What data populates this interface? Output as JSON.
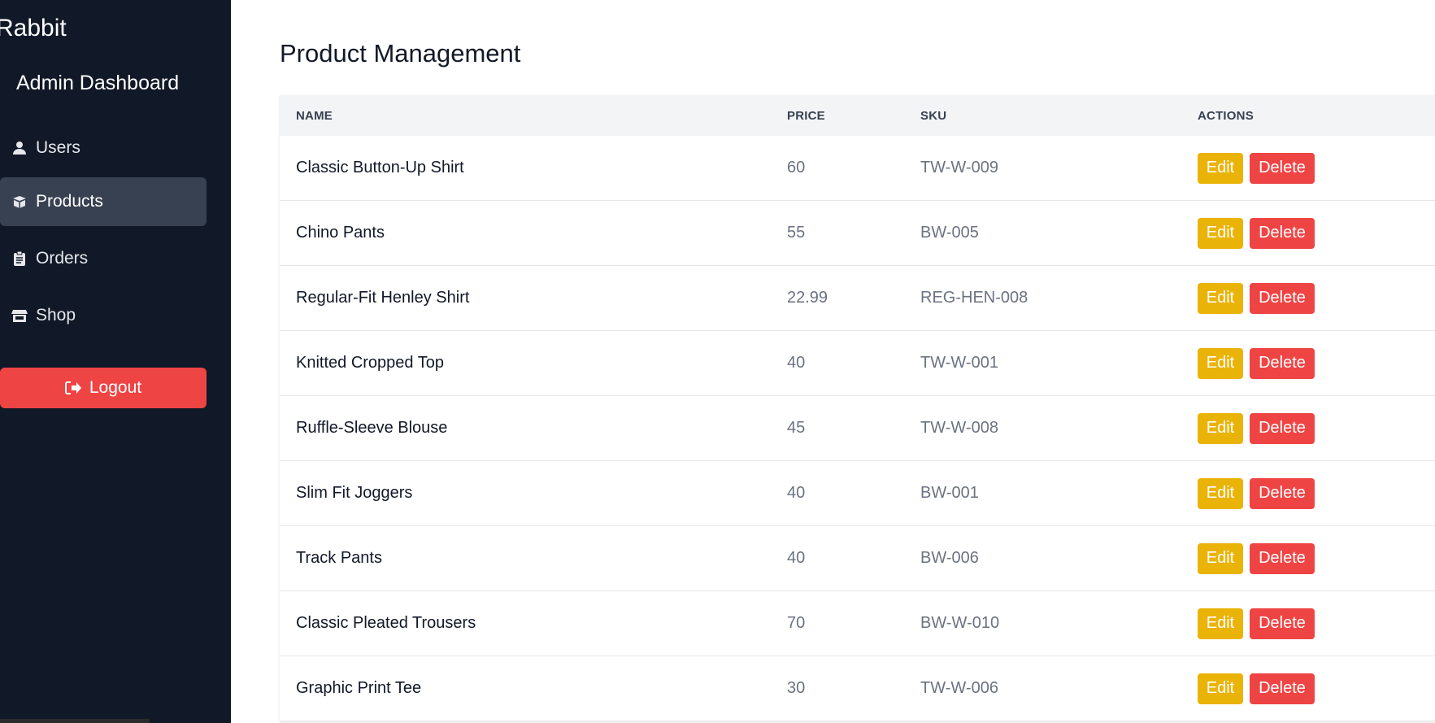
{
  "sidebar": {
    "brand": "Rabbit",
    "subtitle": "Admin Dashboard",
    "items": [
      {
        "label": "Users",
        "icon": "user-icon"
      },
      {
        "label": "Products",
        "icon": "box-icon",
        "active": true
      },
      {
        "label": "Orders",
        "icon": "clipboard-icon"
      },
      {
        "label": "Shop",
        "icon": "store-icon"
      }
    ],
    "logout_label": "Logout"
  },
  "main": {
    "title": "Product Management",
    "columns": [
      "NAME",
      "PRICE",
      "SKU",
      "ACTIONS"
    ],
    "rows": [
      {
        "name": "Classic Button-Up Shirt",
        "price": "60",
        "sku": "TW-W-009"
      },
      {
        "name": "Chino Pants",
        "price": "55",
        "sku": "BW-005"
      },
      {
        "name": "Regular-Fit Henley Shirt",
        "price": "22.99",
        "sku": "REG-HEN-008"
      },
      {
        "name": "Knitted Cropped Top",
        "price": "40",
        "sku": "TW-W-001"
      },
      {
        "name": "Ruffle-Sleeve Blouse",
        "price": "45",
        "sku": "TW-W-008"
      },
      {
        "name": "Slim Fit Joggers",
        "price": "40",
        "sku": "BW-001"
      },
      {
        "name": "Track Pants",
        "price": "40",
        "sku": "BW-006"
      },
      {
        "name": "Classic Pleated Trousers",
        "price": "70",
        "sku": "BW-W-010"
      },
      {
        "name": "Graphic Print Tee",
        "price": "30",
        "sku": "TW-W-006"
      }
    ],
    "edit_label": "Edit",
    "delete_label": "Delete"
  },
  "colors": {
    "sidebar_bg": "#111827",
    "active_item_bg": "#374151",
    "danger": "#ef4444",
    "warning": "#eab308"
  }
}
